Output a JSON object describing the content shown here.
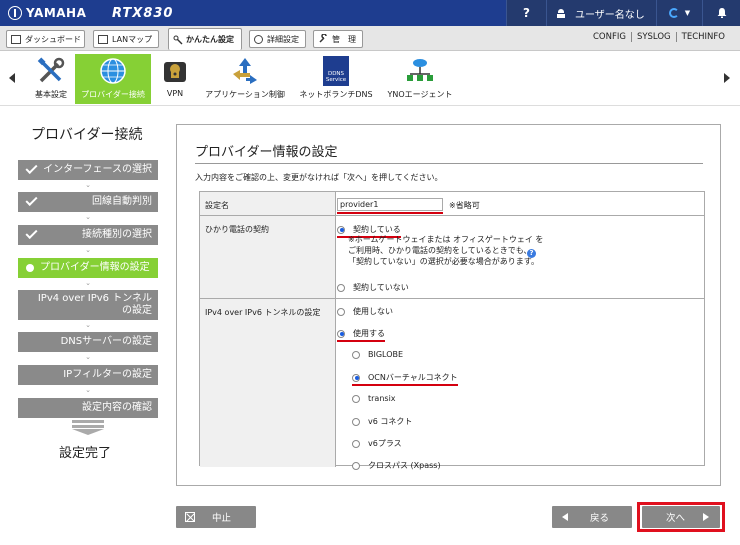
{
  "header": {
    "brand": "YAMAHA",
    "model": "RTX830",
    "help_label": "?",
    "user_label": "ユーザー名なし"
  },
  "tabs": [
    {
      "label": "ダッシュボード"
    },
    {
      "label": "LANマップ"
    },
    {
      "label": "かんたん設定"
    },
    {
      "label": "詳細設定"
    },
    {
      "label": "管　理"
    }
  ],
  "top_links": [
    "CONFIG",
    "SYSLOG",
    "TECHINFO"
  ],
  "toolbar": {
    "items": [
      {
        "label": "基本設定",
        "icon": "tools-icon"
      },
      {
        "label": "プロバイダー接続",
        "icon": "globe-icon"
      },
      {
        "label": "VPN",
        "icon": "vpn-lock-icon"
      },
      {
        "label": "アプリケーション制御",
        "icon": "app-control-icon"
      },
      {
        "label": "ネットボランチDNS",
        "icon": "ddns-service-icon"
      },
      {
        "label": "YNOエージェント",
        "icon": "yno-network-icon"
      }
    ],
    "ddns_icon_text": "DDNS\nService"
  },
  "sidebar": {
    "title": "プロバイダー接続",
    "steps": [
      {
        "label": "インターフェースの選択",
        "state": "done"
      },
      {
        "label": "回線自動判別",
        "state": "done"
      },
      {
        "label": "接続種別の選択",
        "state": "done"
      },
      {
        "label": "プロバイダー情報の設定",
        "state": "current"
      },
      {
        "label": "IPv4 over IPv6 トンネル\nの設定",
        "state": "pending"
      },
      {
        "label": "DNSサーバーの設定",
        "state": "pending"
      },
      {
        "label": "IPフィルターの設定",
        "state": "pending"
      },
      {
        "label": "設定内容の確認",
        "state": "pending"
      }
    ],
    "done_label": "設定完了"
  },
  "main": {
    "title": "プロバイダー情報の設定",
    "description": "入力内容をご確認の上、変更がなければ「次へ」を押してください。",
    "fields": {
      "setting_name": {
        "label": "設定名",
        "value": "provider1",
        "note": "※省略可"
      },
      "hikari_phone": {
        "label": "ひかり電話の契約",
        "options": [
          "契約している",
          "契約していない"
        ],
        "selected": "契約している",
        "note": "※ホームゲートウェイまたは オフィスゲートウェイ を\nご利用時、ひかり電話の契約をしているときでも、\n「契約していない」の選択が必要な場合があります。"
      },
      "ipv4_over_ipv6": {
        "label": "IPv4 over IPv6 トンネルの設定",
        "options": [
          "使用しない",
          "使用する"
        ],
        "selected": "使用する",
        "providers": [
          "BIGLOBE",
          "OCNバーチャルコネクト",
          "transix",
          "v6 コネクト",
          "v6プラス",
          "クロスパス (Xpass)"
        ],
        "selected_provider": "OCNバーチャルコネクト"
      }
    }
  },
  "buttons": {
    "cancel": "中止",
    "back": "戻る",
    "next": "次へ"
  },
  "colors": {
    "header_bg": "#1e3d8f",
    "accent_green": "#86d035",
    "highlight_red": "#d4000f",
    "button_gray": "#888888"
  }
}
